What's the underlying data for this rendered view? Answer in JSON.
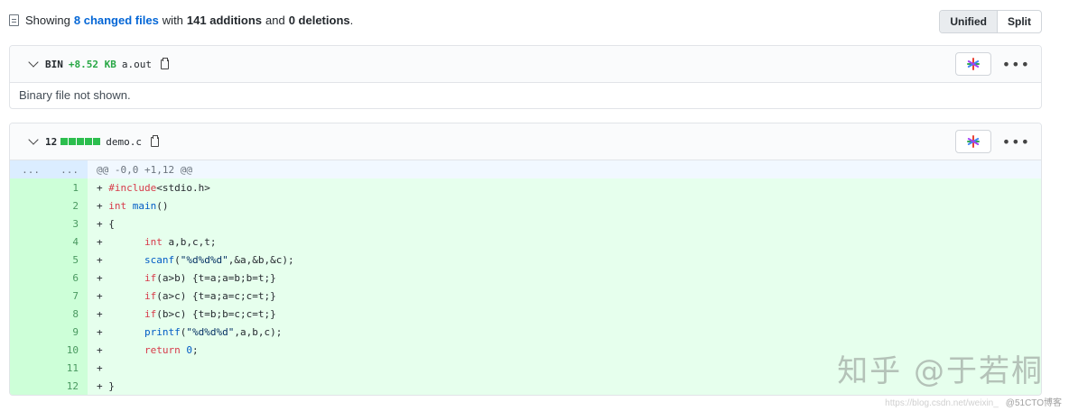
{
  "summary": {
    "prefix": "Showing",
    "changed_link": "8 changed files",
    "mid1": "with",
    "additions": "141 additions",
    "mid2": "and",
    "deletions": "0 deletions",
    "suffix": "."
  },
  "view_toggle": {
    "unified": "Unified",
    "split": "Split",
    "active": "unified"
  },
  "files": [
    {
      "type": "BIN",
      "size": "+8.52 KB",
      "name": "a.out",
      "body_text": "Binary file not shown."
    },
    {
      "count": "12",
      "name": "demo.c",
      "hunk": {
        "old_num": "...",
        "new_num": "...",
        "header": "@@ -0,0 +1,12 @@"
      },
      "lines": [
        "+ #include<stdio.h>",
        "+ int main()",
        "+ {",
        "+       int a,b,c,t;",
        "+       scanf(\"%d%d%d\",&a,&b,&c);",
        "+       if(a>b) {t=a;a=b;b=t;}",
        "+       if(a>c) {t=a;a=c;c=t;}",
        "+       if(b>c) {t=b;b=c;c=t;}",
        "+       printf(\"%d%d%d\",a,b,c);",
        "+       return 0;",
        "+",
        "+ }"
      ]
    }
  ],
  "icons": {
    "star": "colorful-asterisk-icon",
    "more": "kebab-horizontal-icon",
    "copy": "clipboard-icon",
    "chevron": "chevron-down-icon"
  },
  "colors": {
    "addition_bg": "#e6ffed",
    "addition_gutter": "#cdffd8",
    "hunk_bg": "#f1f8ff",
    "link": "#0366d6",
    "green": "#28a745"
  },
  "watermark": "知乎 @于若桐",
  "footer": {
    "faint": "https://blog.csdn.net/weixin_",
    "mark": "@51CTO博客"
  }
}
